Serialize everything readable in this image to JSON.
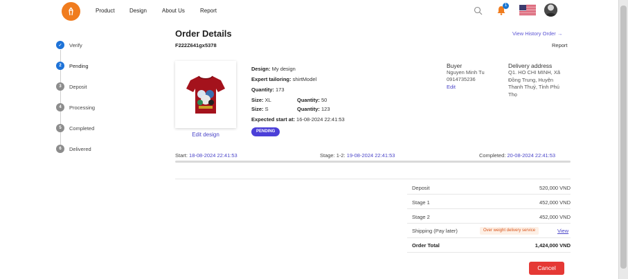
{
  "nav": {
    "items": [
      "Product",
      "Design",
      "About Us",
      "Report"
    ],
    "notification_count": "1",
    "icons": {
      "logo": "brand-logo-icon",
      "search": "search-icon",
      "bell": "bell-icon",
      "flag": "us-flag-icon",
      "avatar": "user-avatar"
    }
  },
  "steps": [
    {
      "label": "Verify",
      "marker": "✓",
      "state": "done"
    },
    {
      "label": "Pending",
      "marker": "2",
      "state": "active"
    },
    {
      "label": "Deposit",
      "marker": "3",
      "state": "todo"
    },
    {
      "label": "Processing",
      "marker": "4",
      "state": "todo"
    },
    {
      "label": "Completed",
      "marker": "5",
      "state": "todo"
    },
    {
      "label": "Delivered",
      "marker": "6",
      "state": "todo"
    }
  ],
  "order": {
    "title": "Order Details",
    "code": "F222Z641gx5378",
    "history_link": "View History Order →",
    "report_link": "Report",
    "edit_design": "Edit design",
    "design_label": "Design:",
    "design_value": "My design",
    "tailoring_label": "Expert tailoring:",
    "tailoring_value": "shirtModel",
    "quantity_label": "Quantity:",
    "quantity_value": "173",
    "sizes": [
      {
        "size_label": "Size:",
        "size": "XL",
        "qty_label": "Quantity:",
        "qty": "50"
      },
      {
        "size_label": "Size:",
        "size": "S",
        "qty_label": "Quantity:",
        "qty": "123"
      }
    ],
    "expected_label": "Expected start at:",
    "expected_value": "16-08-2024 22:41:53",
    "status": "PENDING"
  },
  "buyer": {
    "heading": "Buyer",
    "name": "Nguyen Minh Tu",
    "phone": "0914735236",
    "edit": "Edit"
  },
  "delivery": {
    "heading": "Delivery address",
    "lines": [
      "Q1. HO CHI MINH, Xã",
      "Đồng Trung, Huyện",
      "Thanh Thuỷ, Tỉnh Phú",
      "Thọ"
    ]
  },
  "timeline": {
    "start_label": "Start:",
    "start_value": "18-08-2024 22:41:53",
    "stage_label": "Stage: 1-2:",
    "stage_value": "19-08-2024 22:41:53",
    "completed_label": "Completed:",
    "completed_value": "20-08-2024 22:41:53"
  },
  "summary": {
    "rows": [
      {
        "label": "Deposit",
        "value": "520,000 VND"
      },
      {
        "label": "Stage 1",
        "value": "452,000 VND"
      },
      {
        "label": "Stage 2",
        "value": "452,000 VND"
      }
    ],
    "shipping_label": "Shipping (Pay later)",
    "shipping_badge": "Over weight delivery service",
    "shipping_link": "View",
    "total_label": "Order Total",
    "total_value": "1,424,000 VND"
  },
  "actions": {
    "cancel": "Cancel"
  },
  "colors": {
    "accent": "#4a44c8",
    "step_active": "#1e73d8",
    "cancel": "#e53935",
    "logo": "#f07c1e"
  }
}
